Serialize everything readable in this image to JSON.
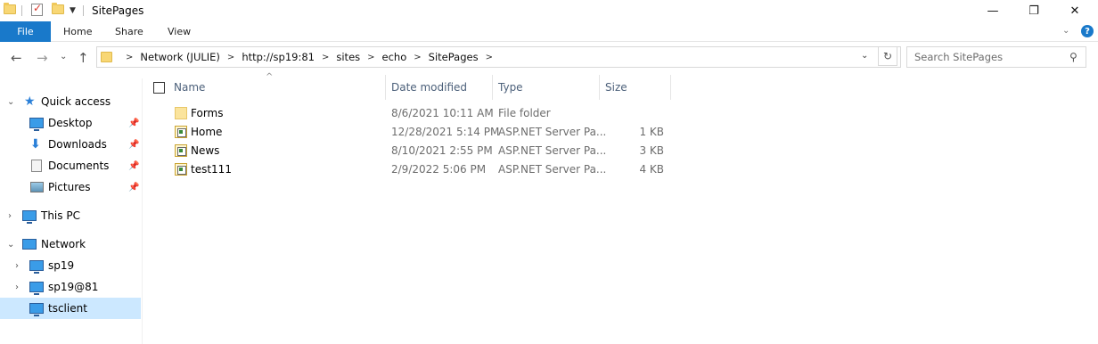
{
  "window": {
    "title": "SitePages",
    "controls": {
      "minimize": "—",
      "maximize": "❐",
      "close": "✕"
    }
  },
  "ribbon": {
    "tabs": [
      "File",
      "Home",
      "Share",
      "View"
    ],
    "expand_glyph": "⌄",
    "help_glyph": "?"
  },
  "nav": {
    "back": "←",
    "forward": "→",
    "recent": "⌄",
    "up": "↑",
    "breadcrumb": [
      "Network (JULIE)",
      "http://sp19:81",
      "sites",
      "echo",
      "SitePages"
    ],
    "breadcrumb_sep": ">",
    "dropdown_glyph": "⌄",
    "refresh_glyph": "↻",
    "search_placeholder": "Search SitePages",
    "search_glyph": "⚲"
  },
  "sidebar": {
    "items": [
      {
        "label": "Quick access",
        "icon": "star-icon",
        "expanded": true
      },
      {
        "label": "Desktop",
        "icon": "desktop-icon",
        "pinned": true
      },
      {
        "label": "Downloads",
        "icon": "downloads-icon",
        "pinned": true
      },
      {
        "label": "Documents",
        "icon": "documents-icon",
        "pinned": true
      },
      {
        "label": "Pictures",
        "icon": "pictures-icon",
        "pinned": true
      },
      {
        "label": "This PC",
        "icon": "computer-icon",
        "expanded": false
      },
      {
        "label": "Network",
        "icon": "network-icon",
        "expanded": true
      },
      {
        "label": "sp19",
        "icon": "computer-icon",
        "expanded": false
      },
      {
        "label": "sp19@81",
        "icon": "computer-icon",
        "expanded": false
      },
      {
        "label": "tsclient",
        "icon": "computer-icon",
        "selected": true
      }
    ],
    "pin_glyph": "📌"
  },
  "files": {
    "columns": [
      "Name",
      "Date modified",
      "Type",
      "Size"
    ],
    "rows": [
      {
        "name": "Forms",
        "date": "8/6/2021 10:11 AM",
        "type": "File folder",
        "size": "",
        "icon": "folder-icon"
      },
      {
        "name": "Home",
        "date": "12/28/2021 5:14 PM",
        "type": "ASP.NET Server Pa...",
        "size": "1 KB",
        "icon": "aspx-file-icon"
      },
      {
        "name": "News",
        "date": "8/10/2021 2:55 PM",
        "type": "ASP.NET Server Pa...",
        "size": "3 KB",
        "icon": "aspx-file-icon"
      },
      {
        "name": "test111",
        "date": "2/9/2022 5:06 PM",
        "type": "ASP.NET Server Pa...",
        "size": "4 KB",
        "icon": "aspx-file-icon"
      }
    ]
  },
  "colors": {
    "file_tab": "#1979ca",
    "selected_item": "#cce8ff",
    "header_text": "#4c607a"
  }
}
